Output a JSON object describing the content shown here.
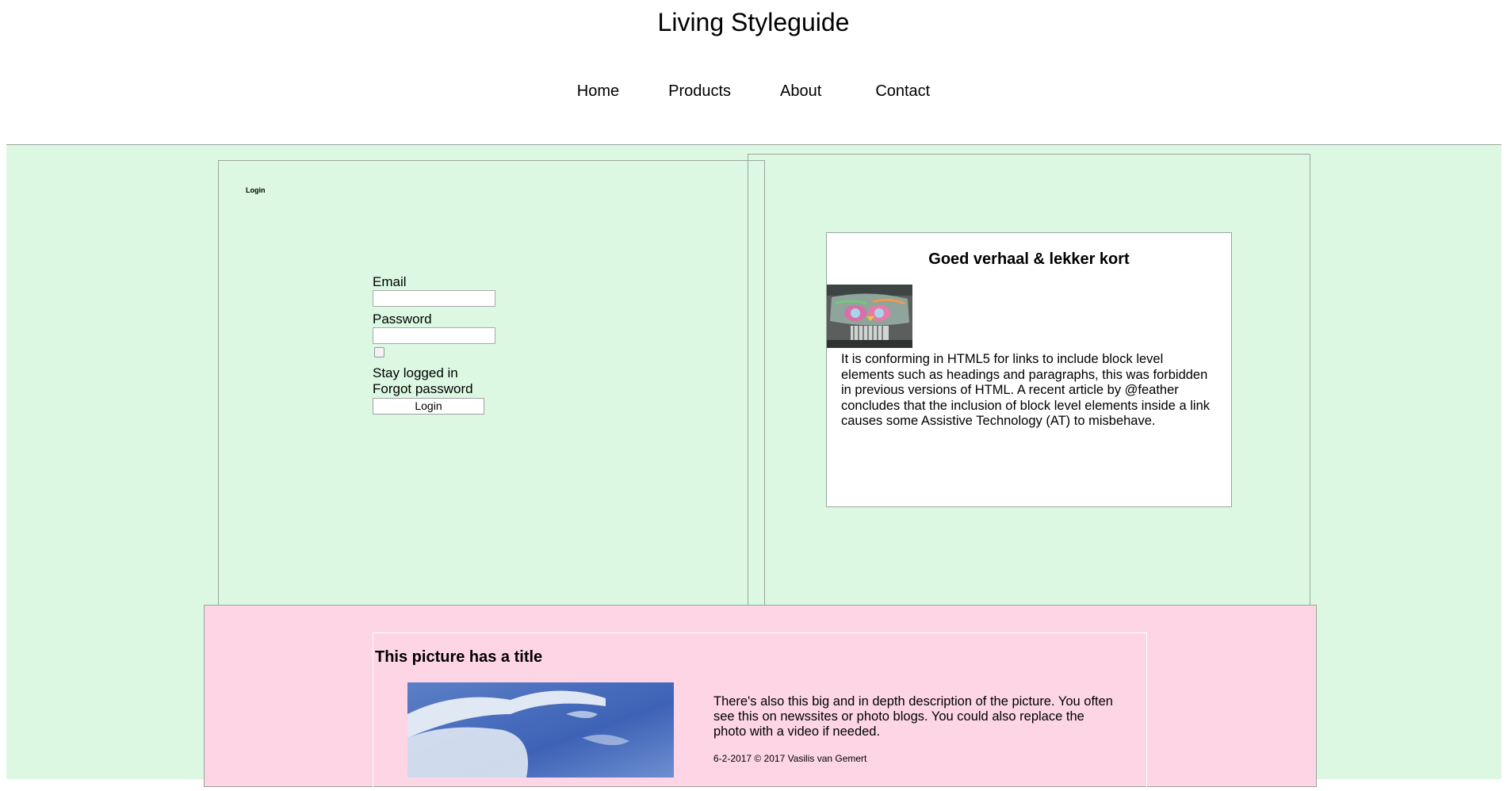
{
  "header": {
    "title": "Living Styleguide",
    "nav": [
      "Home",
      "Products",
      "About",
      "Contact"
    ]
  },
  "login": {
    "legend": "Login",
    "email_label": "Email",
    "email_value": "",
    "password_label": "Password",
    "password_value": "",
    "stay_logged_in": "Stay logged in",
    "stay_logged_in_checked": false,
    "forgot_password": "Forgot password",
    "submit": "Login"
  },
  "article": {
    "title": "Goed verhaal & lekker kort",
    "image_subject": "painted car bonnet",
    "body": "It is conforming in HTML5 for links to include block level elements such as headings and paragraphs, this was forbidden in previous versions of HTML. A recent article by @feather concludes that the inclusion of block level elements inside a link causes some Assistive Technology (AT) to misbehave."
  },
  "figure": {
    "title": "This picture has a title",
    "image_subject": "blue sky with clouds",
    "description": "There's also this big and in depth description of the picture. You often see this on newssites or photo blogs. You could also replace the photo with a video if needed.",
    "credit": "6-2-2017 © 2017 Vasilis van Gemert"
  },
  "colors": {
    "green_background": "#dcf8e3",
    "pink_background": "#fdd5e5",
    "border": "#9aa69c"
  }
}
